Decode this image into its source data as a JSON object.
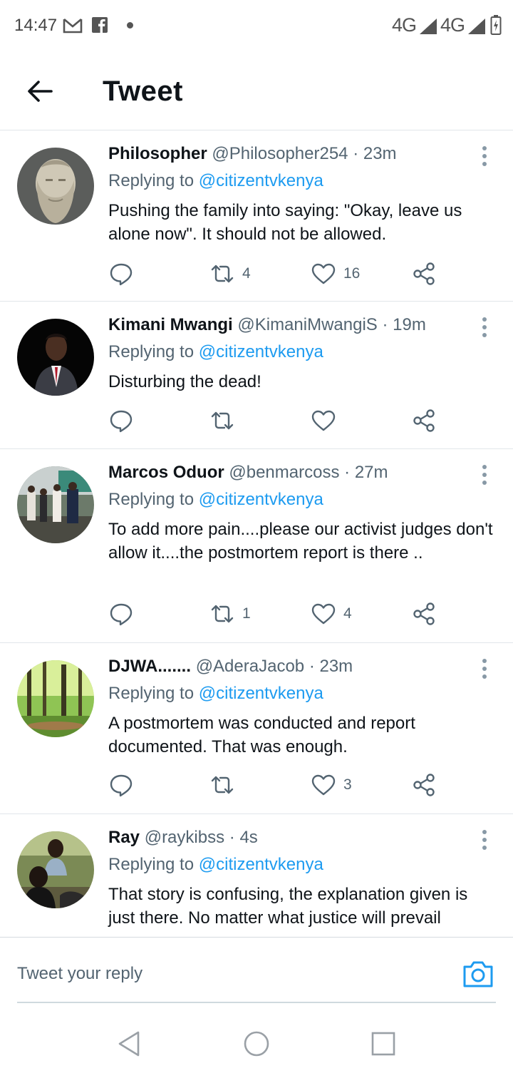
{
  "status_bar": {
    "time": "14:47",
    "icons": [
      "gmail-icon",
      "facebook-icon",
      "notification-dot"
    ],
    "network_1": "4G",
    "network_2": "4G"
  },
  "header": {
    "title": "Tweet",
    "back_icon": "arrow-left-icon"
  },
  "tweets": [
    {
      "name": "Philosopher",
      "handle": "@Philosopher254",
      "time": "23m",
      "replying_prefix": "Replying to",
      "replying_to": "@citizentvkenya",
      "text": "Pushing the family into saying: \"Okay, leave us alone now\". It should not be allowed.",
      "retweets": "4",
      "likes": "16"
    },
    {
      "name": "Kimani Mwangi",
      "handle": "@KimaniMwangiS",
      "time": "19m",
      "replying_prefix": "Replying to",
      "replying_to": "@citizentvkenya",
      "text": "Disturbing the dead!",
      "retweets": "",
      "likes": ""
    },
    {
      "name": "Marcos Oduor",
      "handle": "@benmarcoss",
      "time": "27m",
      "replying_prefix": "Replying to",
      "replying_to": "@citizentvkenya",
      "text": "To add more pain....please our activist judges don't allow it....the postmortem report is there ..",
      "retweets": "1",
      "likes": "4"
    },
    {
      "name": "DJWA.......",
      "handle": "@AderaJacob",
      "time": "23m",
      "replying_prefix": "Replying to",
      "replying_to": "@citizentvkenya",
      "text": "A postmortem was conducted and report documented. That was enough.",
      "retweets": "",
      "likes": "3"
    },
    {
      "name": "Ray",
      "handle": "@raykibss",
      "time": "4s",
      "replying_prefix": "Replying to",
      "replying_to": "@citizentvkenya",
      "text": "That story is confusing, the explanation given is just there. No matter what justice will prevail",
      "retweets": "",
      "likes": ""
    }
  ],
  "reply_bar": {
    "placeholder": "Tweet your reply",
    "camera_icon": "camera-icon"
  },
  "nav_bar": {
    "buttons": [
      "back-triangle-icon",
      "home-circle-icon",
      "recents-square-icon"
    ]
  },
  "colors": {
    "accent": "#1d9bf0",
    "secondary_text": "#536471",
    "primary_text": "#0f1419",
    "divider": "#e1e6ea"
  }
}
